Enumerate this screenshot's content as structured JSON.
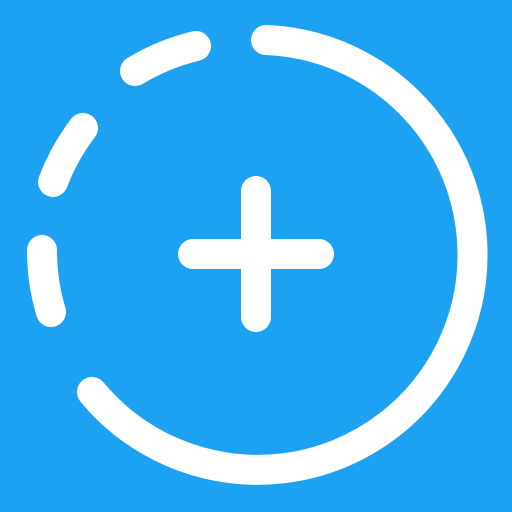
{
  "icon": {
    "name": "add-story-icon",
    "background_color": "#1DA1F2",
    "foreground_color": "#FFFFFF"
  }
}
